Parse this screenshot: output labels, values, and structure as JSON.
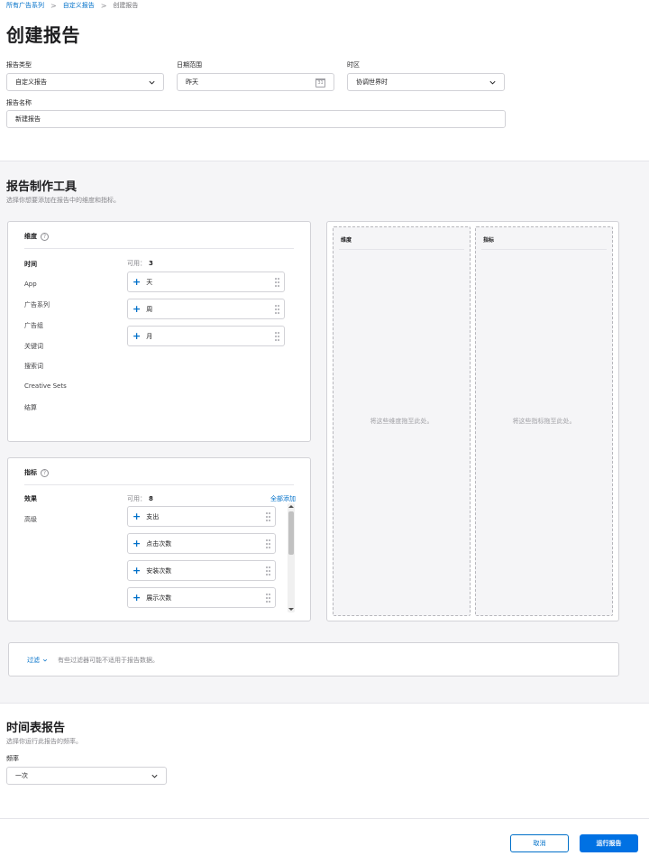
{
  "breadcrumb": {
    "items": [
      "所有广告系列",
      "自定义报告",
      "创建报告"
    ],
    "separator": ">"
  },
  "page_title": "创建报告",
  "form": {
    "report_type": {
      "label": "报告类型",
      "value": "自定义报告"
    },
    "date_range": {
      "label": "日期范围",
      "value": "昨天",
      "calendar_day": "31"
    },
    "timezone": {
      "label": "时区",
      "value": "协调世界时"
    },
    "report_name": {
      "label": "报告名称",
      "value": "新建报告"
    }
  },
  "builder": {
    "title": "报告制作工具",
    "description": "选择你想要添加在报告中的维度和指标。",
    "dimensions_panel": {
      "title": "维度",
      "help": "?",
      "available_label": "可用：",
      "available_count": "3",
      "categories": [
        "时间",
        "App",
        "广告系列",
        "广告组",
        "关键词",
        "搜索词",
        "Creative Sets",
        "结算"
      ],
      "active_category": "时间",
      "items": [
        "天",
        "周",
        "月"
      ]
    },
    "metrics_panel": {
      "title": "指标",
      "help": "?",
      "available_label": "可用：",
      "available_count": "8",
      "add_all": "全部添加",
      "categories": [
        "效果",
        "高级"
      ],
      "active_category": "效果",
      "items": [
        "支出",
        "点击次数",
        "安装次数",
        "展示次数"
      ]
    },
    "drop_zones": {
      "dimensions": {
        "title": "维度",
        "hint": "将这些维度拖至此处。"
      },
      "metrics": {
        "title": "指标",
        "hint": "将这些指标拖至此处。"
      }
    },
    "filter": {
      "label": "过滤",
      "note": "有些过滤器可能不适用于报告数据。"
    }
  },
  "schedule": {
    "title": "时间表报告",
    "description": "选择你运行此报告的频率。",
    "frequency": {
      "label": "频率",
      "value": "一次"
    }
  },
  "actions": {
    "cancel": "取消",
    "run": "运行报告"
  },
  "colors": {
    "accent": "#0070c9",
    "primary_button": "#0071e3",
    "section_bg": "#f5f5f7"
  }
}
